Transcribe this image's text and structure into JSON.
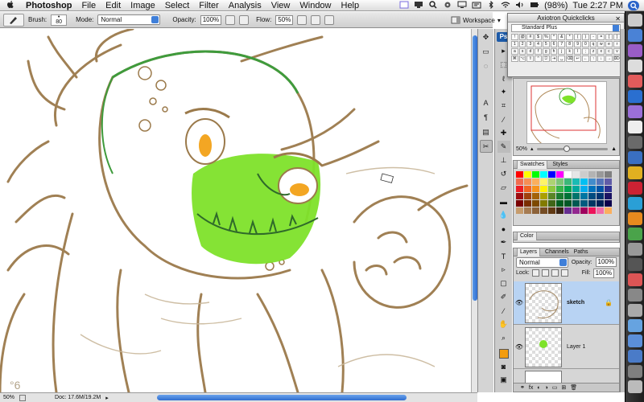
{
  "menubar": {
    "apple": "",
    "app": "Photoshop",
    "items": [
      "File",
      "Edit",
      "Image",
      "Select",
      "Filter",
      "Analysis",
      "View",
      "Window",
      "Help"
    ],
    "battery": "(98%)",
    "clock": "Tue 2:27 PM"
  },
  "options": {
    "brush_label": "Brush:",
    "brush_size": "80",
    "mode_label": "Mode:",
    "mode_value": "Normal",
    "opacity_label": "Opacity:",
    "opacity_value": "100%",
    "flow_label": "Flow:",
    "flow_value": "50%",
    "workspace_label": "Workspace"
  },
  "quickclicks": {
    "title": "Axiotron Quickclicks",
    "preset": "Standard Plus"
  },
  "tools2": {
    "ps_label": "Ps"
  },
  "navigator": {
    "zoom": "50%"
  },
  "swatches": {
    "tabs": [
      "Swatches",
      "Styles"
    ],
    "colors": [
      "#ff0000",
      "#ffff00",
      "#00ff00",
      "#00ffff",
      "#0000ff",
      "#ff00ff",
      "#ffffff",
      "#e6e6e6",
      "#cccccc",
      "#b3b3b3",
      "#999999",
      "#808080",
      "#f26c4f",
      "#f68e55",
      "#fbaf5d",
      "#fff467",
      "#acd372",
      "#7cc576",
      "#3bb878",
      "#1abbb4",
      "#00bff3",
      "#438ccb",
      "#5574b9",
      "#605ca8",
      "#ed1c24",
      "#f26522",
      "#f7941d",
      "#fff200",
      "#8dc73f",
      "#39b54a",
      "#00a651",
      "#00a99d",
      "#00aeef",
      "#0072bc",
      "#0054a6",
      "#2e3192",
      "#9e0b0f",
      "#a0410d",
      "#a36209",
      "#aba000",
      "#598527",
      "#1a7b30",
      "#007236",
      "#00746b",
      "#0076a3",
      "#004b80",
      "#003471",
      "#1b1464",
      "#790000",
      "#7b2e00",
      "#7d4900",
      "#827b00",
      "#406618",
      "#005e20",
      "#005826",
      "#005952",
      "#005b7f",
      "#003663",
      "#002157",
      "#0d004c",
      "#c69c6d",
      "#a67c52",
      "#8c6239",
      "#754c24",
      "#603913",
      "#3c2415",
      "#662d91",
      "#92278f",
      "#9e005d",
      "#ed145b",
      "#f06eaa",
      "#fbaf5d"
    ]
  },
  "color_panel": {
    "tab": "Color"
  },
  "layers": {
    "tabs": [
      "Layers",
      "Channels",
      "Paths"
    ],
    "blend_mode": "Normal",
    "opacity_label": "Opacity:",
    "opacity": "100%",
    "lock_label": "Lock:",
    "fill_label": "Fill:",
    "fill": "100%",
    "items": [
      {
        "name": "sketch"
      },
      {
        "name": "Layer 1"
      },
      {
        "name": ""
      }
    ]
  },
  "statusbar": {
    "zoom": "50%",
    "doc": "Doc: 17.6M/19.2M"
  },
  "colors": {
    "accent": "#3f7fd9",
    "layer_selected": "#b8d3f3",
    "green_fill": "#7ee22a"
  }
}
